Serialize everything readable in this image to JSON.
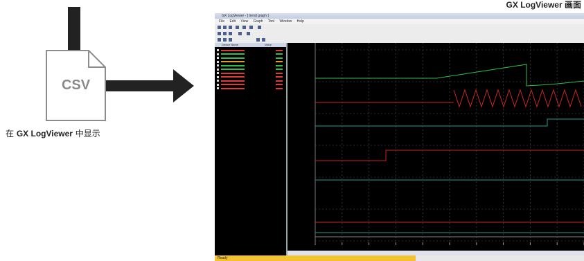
{
  "caption_top": "GX LogViewer 画面",
  "caption_left_prefix": "在 ",
  "caption_left_bold": "GX LogViewer",
  "caption_left_suffix": " 中显示",
  "file_label": "CSV",
  "colors": {
    "arrow": "#222222",
    "doc_outline": "#8c8c8c",
    "plot_bg": "#000000",
    "trend_green": "#2fbf4a",
    "trend_red": "#c8281e",
    "trend_teal": "#1e9e8c",
    "statusbar_accent": "#f4c230"
  },
  "window": {
    "title": "GX LogViewer - [ trend graph ]",
    "menu": [
      "File",
      "Edit",
      "View",
      "Graph",
      "Tool",
      "Window",
      "Help"
    ],
    "left_pane_header": [
      "Device Name",
      "Value"
    ],
    "status_left": "Ready",
    "status_right_1": "",
    "status_right_2": ""
  },
  "left_pane_rows": [
    {
      "color": "#e23a3a"
    },
    {
      "color": "#2fbf4a"
    },
    {
      "color": "#2fbf4a"
    },
    {
      "color": "#e0a020"
    },
    {
      "color": "#2fbf4a"
    },
    {
      "color": "#2fbf4a"
    },
    {
      "color": "#e23a3a"
    },
    {
      "color": "#e23a3a"
    },
    {
      "color": "#e23a3a"
    },
    {
      "color": "#e23a3a"
    },
    {
      "color": "#e23a3a"
    }
  ],
  "x_tick_count": 10
}
